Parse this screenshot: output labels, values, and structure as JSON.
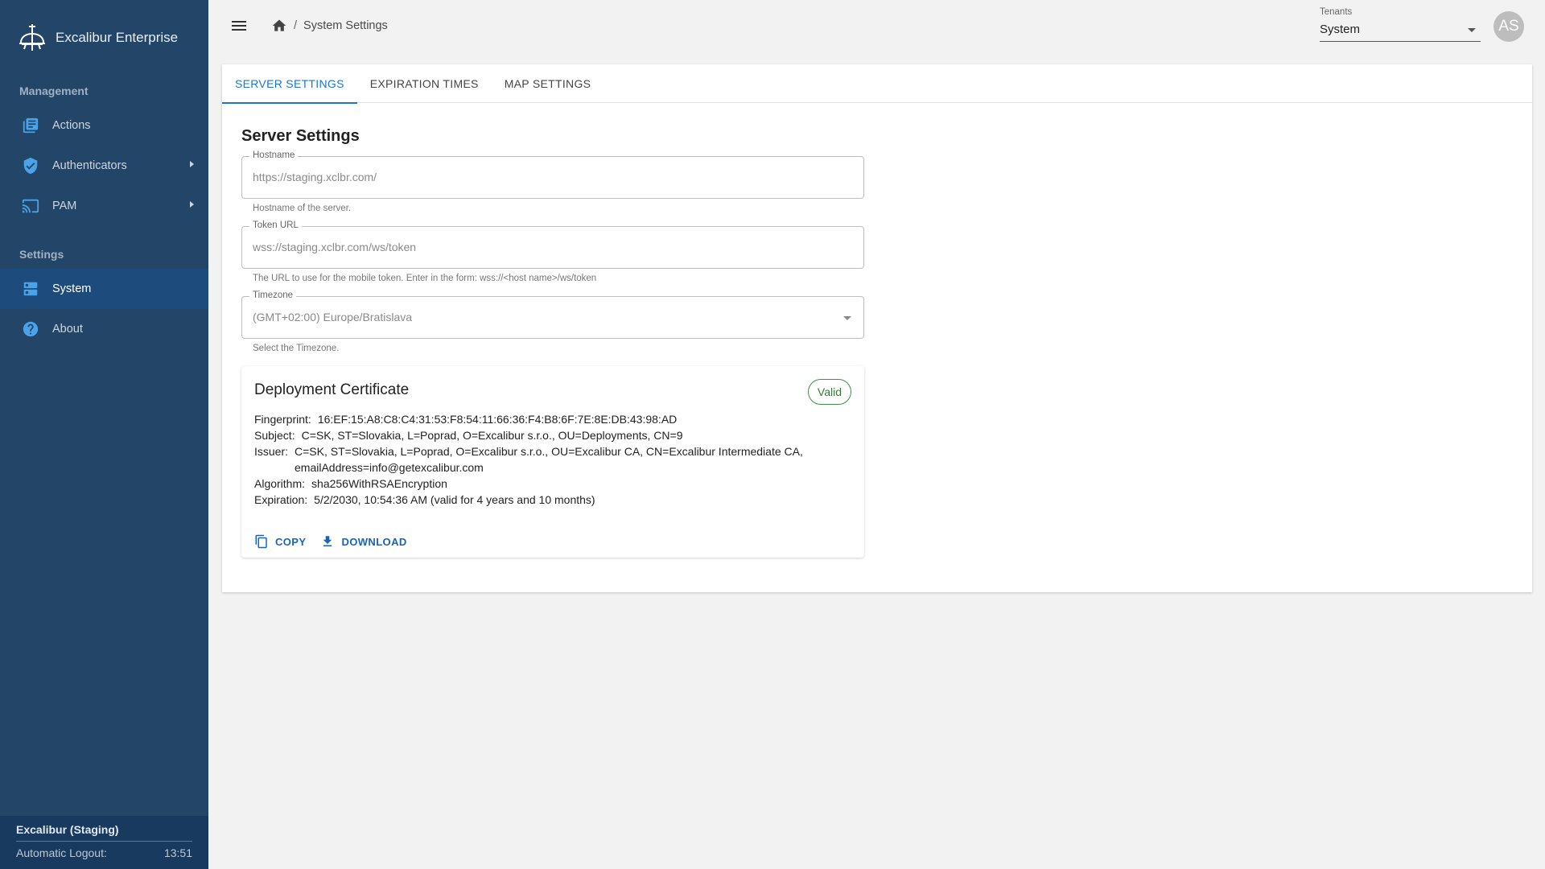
{
  "app": {
    "brand_name": "Excalibur Enterprise"
  },
  "sidebar": {
    "sections": [
      {
        "label": "Management",
        "items": [
          {
            "label": "Actions",
            "icon": "list-icon"
          },
          {
            "label": "Authenticators",
            "icon": "shield-check-icon",
            "has_submenu": true
          },
          {
            "label": "PAM",
            "icon": "cast-icon",
            "has_submenu": true
          }
        ]
      },
      {
        "label": "Settings",
        "items": [
          {
            "label": "System",
            "icon": "dns-icon",
            "active": true
          },
          {
            "label": "About",
            "icon": "help-circle-icon"
          }
        ]
      }
    ],
    "footer": {
      "environment": "Excalibur (Staging)",
      "logout_label": "Automatic Logout:",
      "logout_time": "13:51"
    }
  },
  "topbar": {
    "breadcrumb_separator": "/",
    "breadcrumb_current": "System Settings",
    "tenants_label": "Tenants",
    "tenants_value": "System",
    "avatar_initials": "AS"
  },
  "tabs": [
    {
      "label": "SERVER SETTINGS",
      "active": true
    },
    {
      "label": "EXPIRATION TIMES",
      "active": false
    },
    {
      "label": "MAP SETTINGS",
      "active": false
    }
  ],
  "server_settings": {
    "title": "Server Settings",
    "hostname": {
      "label": "Hostname",
      "value": "https://staging.xclbr.com/",
      "helper": "Hostname of the server."
    },
    "token_url": {
      "label": "Token URL",
      "value": "wss://staging.xclbr.com/ws/token",
      "helper": "The URL to use for the mobile token. Enter in the form: wss://<host name>/ws/token"
    },
    "timezone": {
      "label": "Timezone",
      "value": "(GMT+02:00) Europe/Bratislava",
      "helper": "Select the Timezone."
    }
  },
  "certificate": {
    "title": "Deployment Certificate",
    "status": "Valid",
    "status_color": "#2e7d32",
    "fields": {
      "fingerprint": {
        "key": "Fingerprint:",
        "value": "16:EF:15:A8:C8:C4:31:53:F8:54:11:66:36:F4:B8:6F:7E:8E:DB:43:98:AD"
      },
      "subject": {
        "key": "Subject:",
        "value": "C=SK, ST=Slovakia, L=Poprad, O=Excalibur s.r.o., OU=Deployments, CN=9"
      },
      "issuer": {
        "key": "Issuer:",
        "value": "C=SK, ST=Slovakia, L=Poprad, O=Excalibur s.r.o., OU=Excalibur CA, CN=Excalibur Intermediate CA, emailAddress=info@getexcalibur.com"
      },
      "algorithm": {
        "key": "Algorithm:",
        "value": "sha256WithRSAEncryption"
      },
      "expiration": {
        "key": "Expiration:",
        "value": "5/2/2030, 10:54:36 AM (valid for 4 years and 10 months)"
      }
    },
    "actions": {
      "copy": "COPY",
      "download": "DOWNLOAD"
    }
  },
  "colors": {
    "sidebar_bg": "#234567",
    "sidebar_active": "#1d4c7c",
    "accent": "#1976d2",
    "icon_blue": "#4aa3e8"
  }
}
